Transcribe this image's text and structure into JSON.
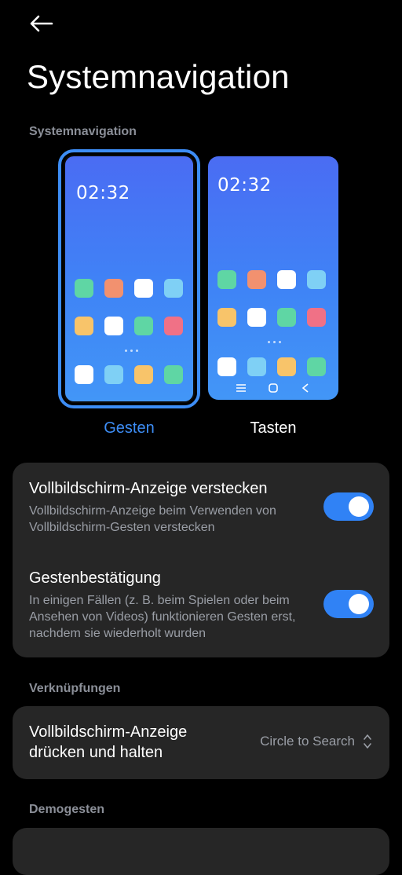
{
  "header": {
    "back_icon": "arrow-left-icon",
    "title": "Systemnavigation"
  },
  "nav_section": {
    "label": "Systemnavigation",
    "options": [
      {
        "label": "Gesten",
        "selected": true,
        "clock": "02:32"
      },
      {
        "label": "Tasten",
        "selected": false,
        "clock": "02:32"
      }
    ],
    "navbar_icons": [
      "menu-icon",
      "home-icon",
      "back-icon"
    ]
  },
  "settings": {
    "hide_indicator": {
      "title": "Vollbildschirm-Anzeige verstecken",
      "description": "Vollbildschirm-Anzeige beim Verwenden von Vollbildschirm-Gesten verstecken",
      "enabled": true
    },
    "gesture_confirm": {
      "title": "Gestenbestätigung",
      "description": "In einigen Fällen (z. B. beim Spielen oder beim Ansehen von Videos) funktionieren Gesten erst, nachdem sie wiederholt wurden",
      "enabled": true
    }
  },
  "shortcuts": {
    "label": "Verknüpfungen",
    "item": {
      "title": "Vollbildschirm-Anzeige drücken und halten",
      "value": "Circle to Search"
    }
  },
  "demo": {
    "label": "Demogesten"
  },
  "colors": {
    "accent": "#3d8df5",
    "toggle_on": "#3082f5",
    "card_bg": "#262626",
    "secondary_text": "#9a9ea6"
  }
}
